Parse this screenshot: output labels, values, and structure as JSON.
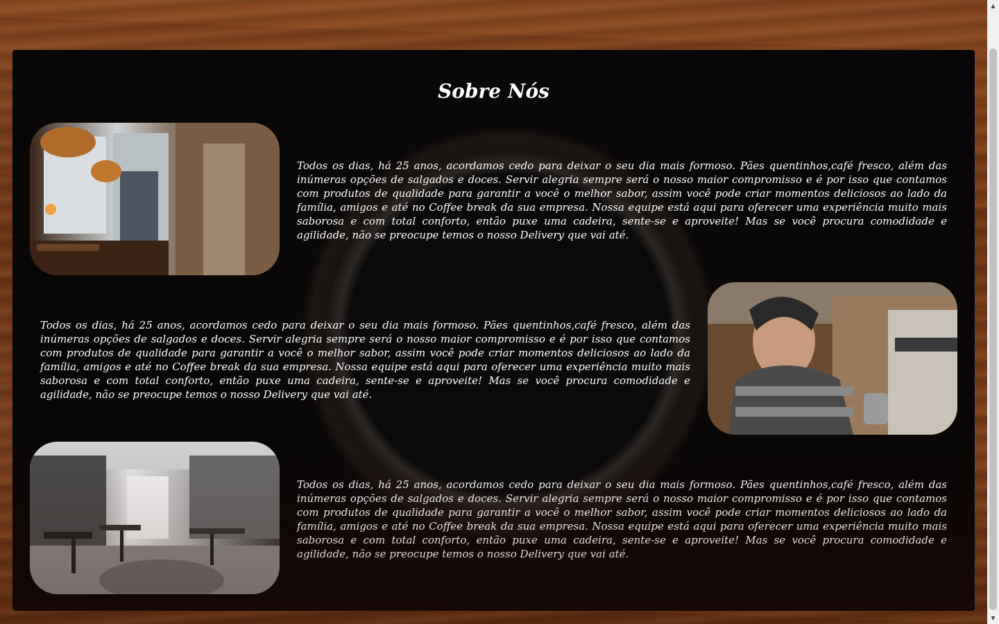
{
  "section": {
    "title": "Sobre Nós"
  },
  "rows": [
    {
      "image": "cafe-interior-photo",
      "text": "Todos os dias, há 25 anos, acordamos cedo para deixar o seu dia mais formoso. Pães quentinhos,café fresco, além das inúmeras opções de salgados e doces. Servir alegria sempre será o nosso maior compromisso e é por isso que contamos com produtos de qualidade para garantir a você o melhor sabor, assim você pode criar momentos deliciosos ao lado da família, amigos e até no Coffee break da sua empresa. Nossa equipe está aqui para oferecer uma experiência muito mais saborosa e com total conforto, então puxe uma cadeira, sente-se e aproveite! Mas se você procura comodidade e agilidade, não se preocupe temos o nosso Delivery que vai até."
    },
    {
      "image": "barista-photo",
      "text": "Todos os dias, há 25 anos, acordamos cedo para deixar o seu dia mais formoso. Pães quentinhos,café fresco, além das inúmeras opções de salgados e doces. Servir alegria sempre será o nosso maior compromisso e é por isso que contamos com produtos de qualidade para garantir a você o melhor sabor, assim você pode criar momentos deliciosos ao lado da família, amigos e até no Coffee break da sua empresa. Nossa equipe está aqui para oferecer uma experiência muito mais saborosa e com total conforto, então puxe uma cadeira, sente-se e aproveite! Mas se você procura comodidade e agilidade, não se preocupe temos o nosso Delivery que vai até."
    },
    {
      "image": "cafe-dining-room-bw-photo",
      "text": "Todos os dias, há 25 anos, acordamos cedo para deixar o seu dia mais formoso. Pães quentinhos,café fresco, além das inúmeras opções de salgados e doces. Servir alegria sempre será o nosso maior compromisso e é por isso que contamos com produtos de qualidade para garantir a você o melhor sabor, assim você pode criar momentos deliciosos ao lado da família, amigos e até no Coffee break da sua empresa. Nossa equipe está aqui para oferecer uma experiência muito mais saborosa e com total conforto, então puxe uma cadeira, sente-se e aproveite! Mas se você procura comodidade e agilidade, não se preocupe temos o nosso Delivery que vai até."
    }
  ],
  "colors": {
    "text": "#ffffff",
    "panel": "#0c0909",
    "wood": "#7a4020"
  }
}
